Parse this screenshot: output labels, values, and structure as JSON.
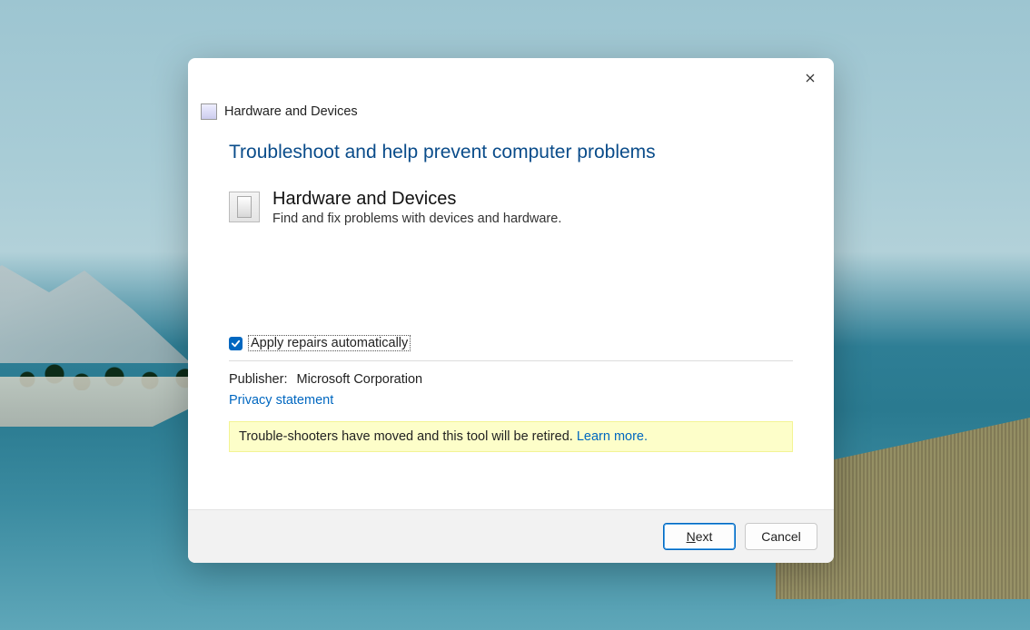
{
  "header": {
    "title": "Hardware and Devices"
  },
  "main": {
    "page_title": "Troubleshoot and help prevent computer problems",
    "item": {
      "title": "Hardware and Devices",
      "description": "Find and fix problems with devices and hardware."
    },
    "auto_repair_label": "Apply repairs automatically",
    "publisher_label": "Publisher:",
    "publisher_value": "Microsoft Corporation",
    "privacy_link": "Privacy statement",
    "notice_text": "Trouble-shooters have moved and this tool will be retired. ",
    "notice_link": "Learn more."
  },
  "footer": {
    "next_prefix": "N",
    "next_suffix": "ext",
    "cancel": "Cancel"
  }
}
